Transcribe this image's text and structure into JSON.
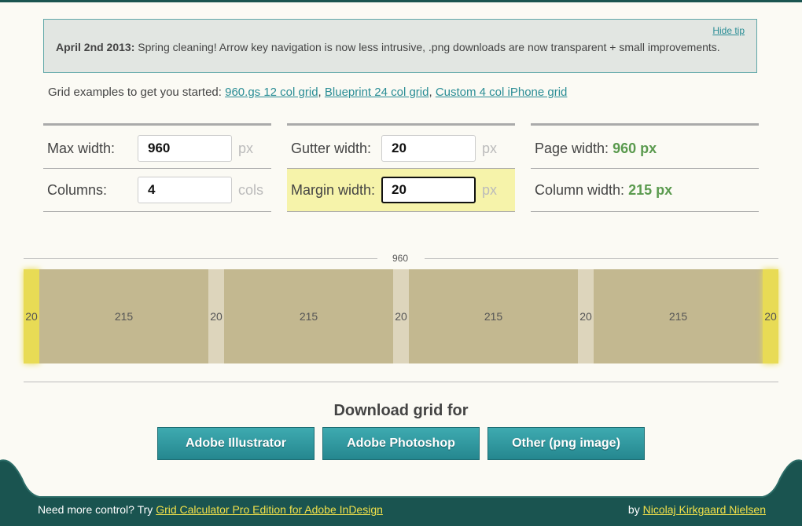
{
  "tip": {
    "date": "April 2nd 2013:",
    "text": "Spring cleaning! Arrow key navigation is now less intrusive, .png downloads are now transparent + small improvements.",
    "hide_label": "Hide tip"
  },
  "examples": {
    "intro": "Grid examples to get you started:",
    "links": [
      "960.gs 12 col grid",
      "Blueprint 24 col grid",
      "Custom 4 col iPhone grid"
    ]
  },
  "settings": {
    "max_width": {
      "label": "Max width:",
      "value": "960",
      "unit": "px"
    },
    "columns": {
      "label": "Columns:",
      "value": "4",
      "unit": "cols"
    },
    "gutter_width": {
      "label": "Gutter width:",
      "value": "20",
      "unit": "px"
    },
    "margin_width": {
      "label": "Margin width:",
      "value": "20",
      "unit": "px"
    }
  },
  "results": {
    "page_width": {
      "label": "Page width:",
      "value": "960 px"
    },
    "column_width": {
      "label": "Column width:",
      "value": "215 px"
    }
  },
  "grid_preview": {
    "total_label": "960",
    "segments": [
      {
        "kind": "margin",
        "value": "20"
      },
      {
        "kind": "col",
        "value": "215"
      },
      {
        "kind": "gutter",
        "value": "20"
      },
      {
        "kind": "col",
        "value": "215"
      },
      {
        "kind": "gutter",
        "value": "20"
      },
      {
        "kind": "col",
        "value": "215"
      },
      {
        "kind": "gutter",
        "value": "20"
      },
      {
        "kind": "col",
        "value": "215"
      },
      {
        "kind": "margin",
        "value": "20"
      }
    ]
  },
  "download": {
    "title": "Download grid for",
    "buttons": [
      "Adobe Illustrator",
      "Adobe Photoshop",
      "Other (png image)"
    ]
  },
  "footer": {
    "left_text": "Need more control? Try",
    "left_link": "Grid Calculator Pro Edition for Adobe InDesign",
    "right_text": "by",
    "right_link": "Nicolaj Kirkgaard Nielsen"
  },
  "colors": {
    "accent": "#2a8d95",
    "footer_bg": "#1a5450",
    "margin": "#e8db55",
    "column": "#c3b890",
    "gutter": "#ddd5bc",
    "result": "#5a9a4e"
  }
}
